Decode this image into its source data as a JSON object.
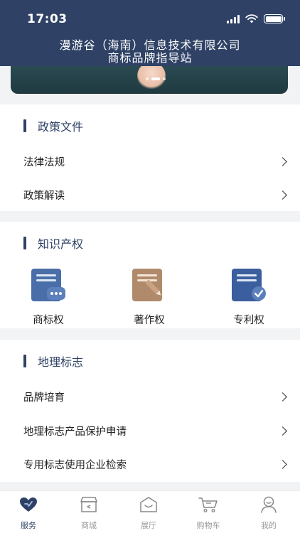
{
  "status_bar": {
    "time": "17:03"
  },
  "header": {
    "title_line1": "漫游谷（海南）信息技术有限公司",
    "title_line2": "商标品牌指导站"
  },
  "policy": {
    "title": "政策文件",
    "items": [
      {
        "label": "法律法规"
      },
      {
        "label": "政策解读"
      }
    ]
  },
  "ip": {
    "title": "知识产权",
    "items": [
      {
        "label": "商标权"
      },
      {
        "label": "著作权"
      },
      {
        "label": "专利权"
      }
    ]
  },
  "geo": {
    "title": "地理标志",
    "items": [
      {
        "label": "品牌培育"
      },
      {
        "label": "地理标志产品保护申请"
      },
      {
        "label": "专用标志使用企业检索"
      }
    ]
  },
  "tabbar": {
    "active": "服务",
    "items": [
      {
        "label": "服务"
      },
      {
        "label": "商城"
      },
      {
        "label": "展厅"
      },
      {
        "label": "购物车"
      },
      {
        "label": "我的"
      }
    ]
  },
  "colors": {
    "primary": "#2f4266",
    "background": "#f2f3f5",
    "icon_blue": "#4a6ea8",
    "icon_tan": "#b08a6a"
  }
}
